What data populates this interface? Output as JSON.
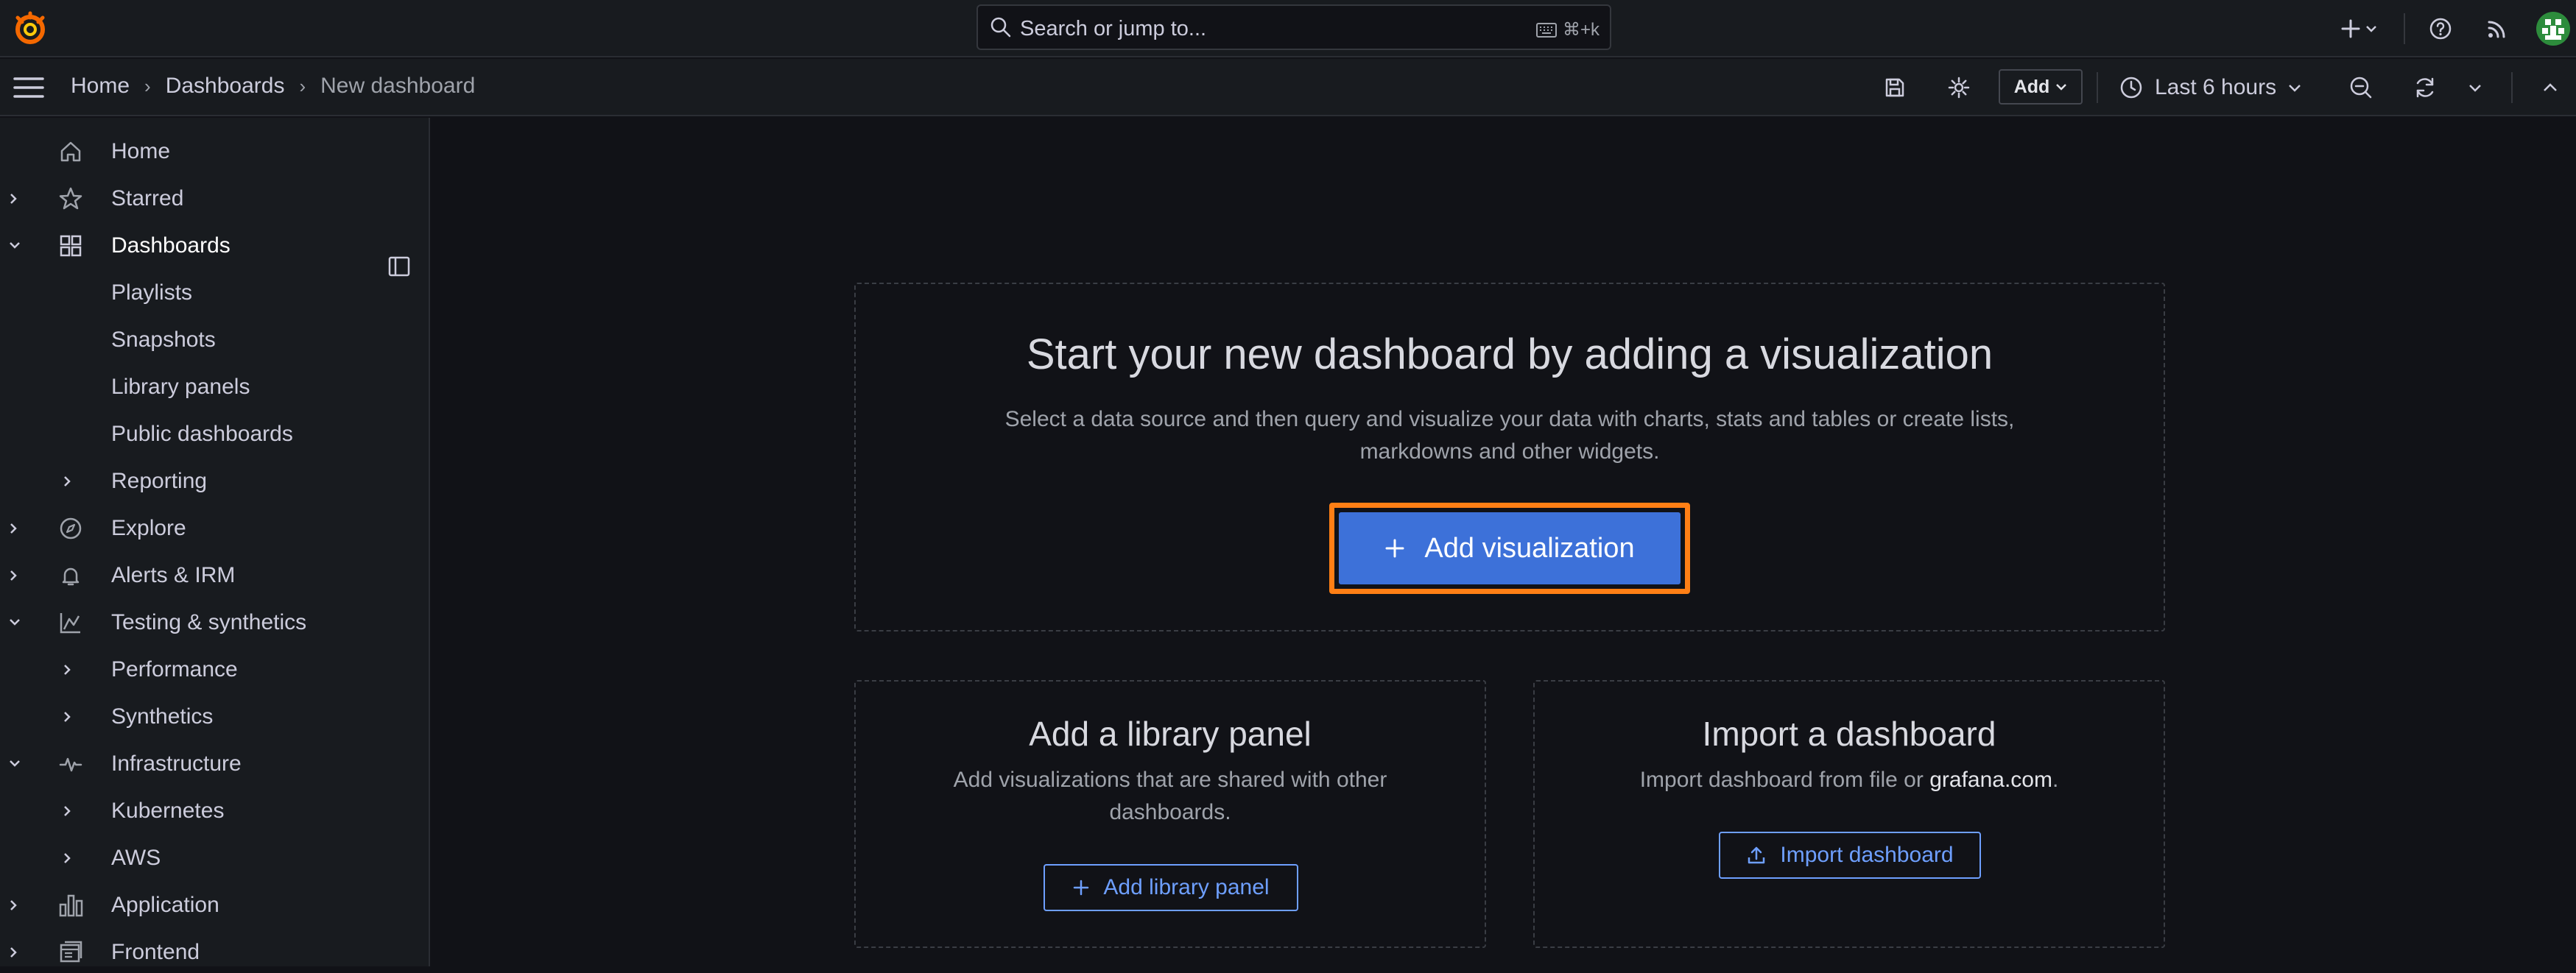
{
  "topbar": {
    "search_placeholder": "Search or jump to...",
    "search_shortcut": "⌘+k",
    "icons": [
      "grafana-logo",
      "search-icon",
      "keyboard-icon",
      "plus-icon",
      "chevron-down-icon",
      "help-icon",
      "rss-icon",
      "avatar"
    ]
  },
  "breadcrumb": {
    "items": [
      "Home",
      "Dashboards",
      "New dashboard"
    ]
  },
  "toolbar": {
    "add_label": "Add",
    "time_range": "Last 6 hours",
    "icons": [
      "save-icon",
      "gear-icon",
      "clock-icon",
      "zoom-out-icon",
      "refresh-icon",
      "chevron-down-icon",
      "chevron-up-icon"
    ]
  },
  "sidebar": {
    "items": [
      {
        "label": "Home"
      },
      {
        "label": "Starred"
      },
      {
        "label": "Dashboards"
      },
      {
        "label": "Playlists"
      },
      {
        "label": "Snapshots"
      },
      {
        "label": "Library panels"
      },
      {
        "label": "Public dashboards"
      },
      {
        "label": "Reporting"
      },
      {
        "label": "Explore"
      },
      {
        "label": "Alerts & IRM"
      },
      {
        "label": "Testing & synthetics"
      },
      {
        "label": "Performance"
      },
      {
        "label": "Synthetics"
      },
      {
        "label": "Infrastructure"
      },
      {
        "label": "Kubernetes"
      },
      {
        "label": "AWS"
      },
      {
        "label": "Application"
      },
      {
        "label": "Frontend"
      }
    ]
  },
  "main": {
    "hero": {
      "title": "Start your new dashboard by adding a visualization",
      "desc_line1": "Select a data source and then query and visualize your data with charts, stats and tables or create lists,",
      "desc_line2": "markdowns and other widgets.",
      "button": "Add visualization"
    },
    "library": {
      "title": "Add a library panel",
      "desc_line1": "Add visualizations that are shared with other",
      "desc_line2": "dashboards.",
      "button": "Add library panel"
    },
    "import": {
      "title": "Import a dashboard",
      "desc_prefix": "Import dashboard from file or ",
      "desc_link": "grafana.com",
      "desc_suffix": ".",
      "button": "Import dashboard"
    }
  },
  "colors": {
    "accent_blue": "#3d71d9",
    "highlight_orange": "#ff7f15",
    "link_blue": "#6e9fff",
    "background": "#111217",
    "panel": "#181b1f"
  }
}
